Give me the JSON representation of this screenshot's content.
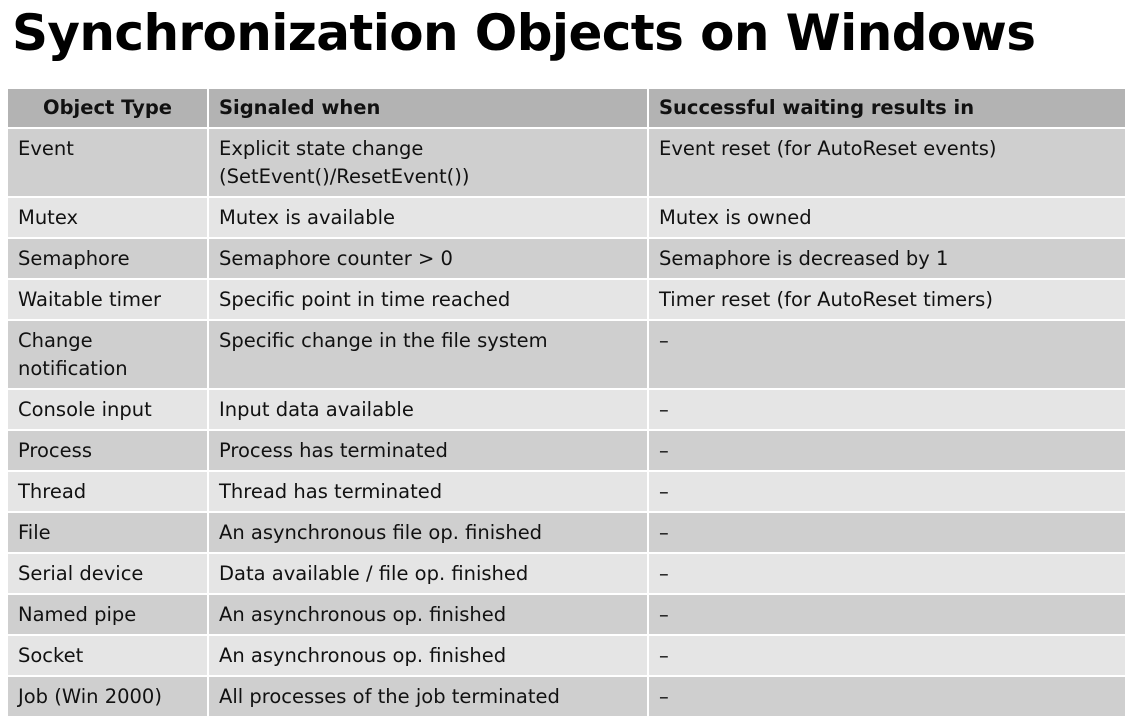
{
  "slide": {
    "title": "Synchronization Objects on Windows"
  },
  "table": {
    "headers": [
      "Object Type",
      "Signaled when",
      "Successful waiting results in"
    ],
    "rows": [
      {
        "type": "Event",
        "signaled": "Explicit state change (SetEvent()/ResetEvent())",
        "result": "Event reset (for AutoReset events)"
      },
      {
        "type": "Mutex",
        "signaled": "Mutex is available",
        "result": "Mutex is owned"
      },
      {
        "type": "Semaphore",
        "signaled": "Semaphore counter > 0",
        "result": "Semaphore is decreased by 1"
      },
      {
        "type": "Waitable timer",
        "signaled": "Specific point in time reached",
        "result": "Timer reset (for AutoReset timers)"
      },
      {
        "type": "Change notification",
        "signaled": "Specific change in the file system",
        "result": "–"
      },
      {
        "type": "Console input",
        "signaled": "Input data available",
        "result": "–"
      },
      {
        "type": "Process",
        "signaled": "Process has terminated",
        "result": "–"
      },
      {
        "type": "Thread",
        "signaled": "Thread has terminated",
        "result": "–"
      },
      {
        "type": "File",
        "signaled": "An asynchronous file op. finished",
        "result": "–"
      },
      {
        "type": "Serial device",
        "signaled": "Data available / file op. finished",
        "result": "–"
      },
      {
        "type": "Named pipe",
        "signaled": "An asynchronous op. finished",
        "result": "–"
      },
      {
        "type": "Socket",
        "signaled": "An asynchronous op. finished",
        "result": "–"
      },
      {
        "type": "Job (Win 2000)",
        "signaled": "All processes of the job terminated",
        "result": "–"
      }
    ]
  }
}
